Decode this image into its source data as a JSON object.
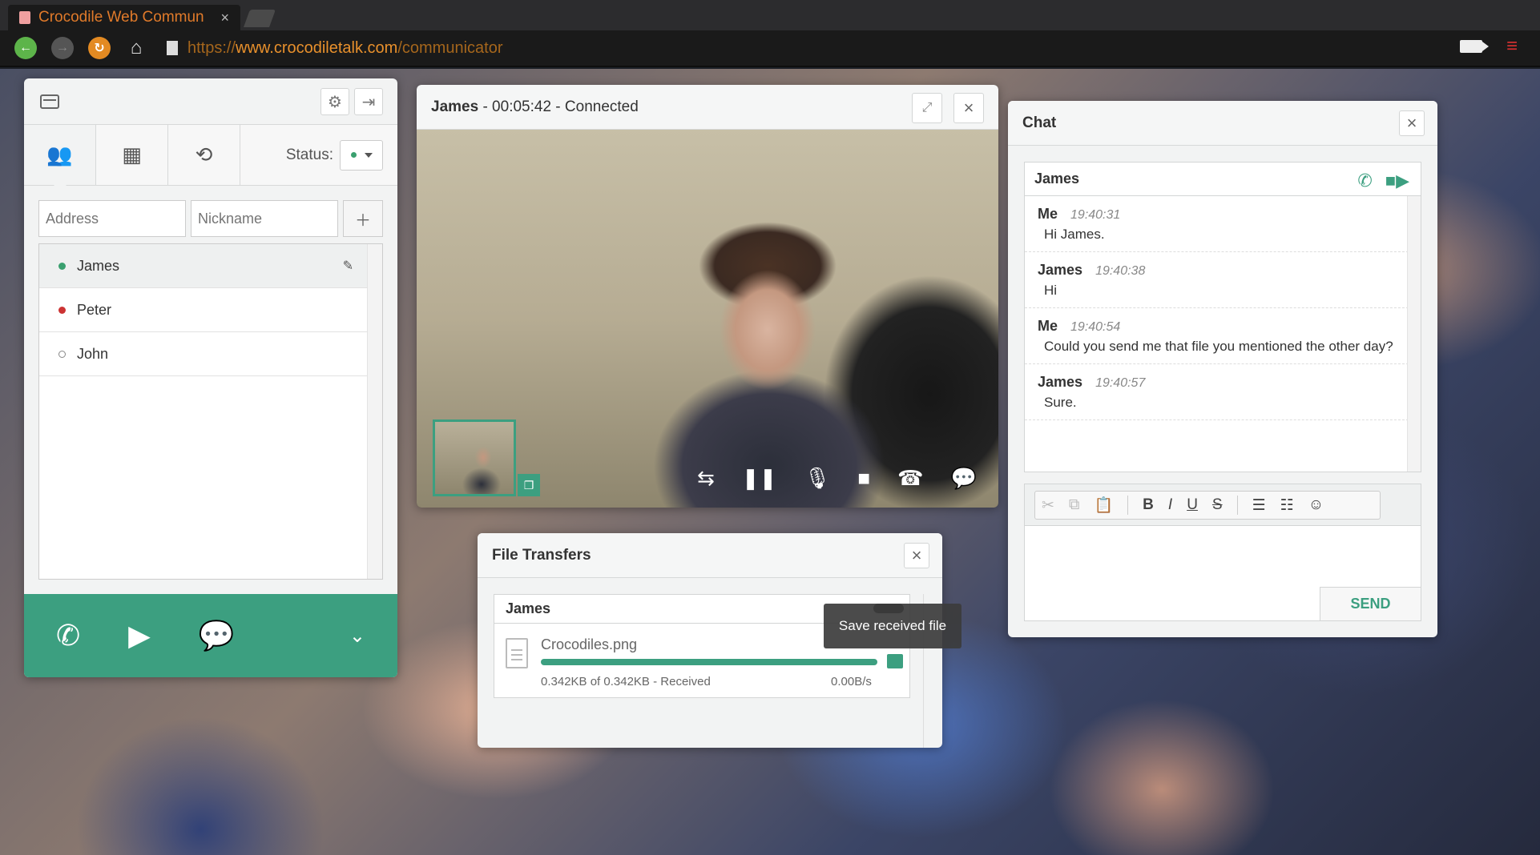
{
  "browser": {
    "tab_title": "Crocodile Web Commun",
    "url_scheme": "https://",
    "url_host": "www.crocodiletalk.com",
    "url_path": "/communicator"
  },
  "contacts": {
    "status_label": "Status:",
    "address_placeholder": "Address",
    "nickname_placeholder": "Nickname",
    "items": [
      {
        "name": "James",
        "status": "online"
      },
      {
        "name": "Peter",
        "status": "busy"
      },
      {
        "name": "John",
        "status": "offline"
      }
    ]
  },
  "video": {
    "caller": "James",
    "meta": " - 00:05:42 - Connected"
  },
  "chat": {
    "title": "Chat",
    "contact": "James",
    "messages": [
      {
        "from": "Me",
        "time": "19:40:31",
        "text": "Hi James."
      },
      {
        "from": "James",
        "time": "19:40:38",
        "text": "Hi"
      },
      {
        "from": "Me",
        "time": "19:40:54",
        "text": "Could you send me that file you mentioned the other day?"
      },
      {
        "from": "James",
        "time": "19:40:57",
        "text": "Sure."
      }
    ],
    "send_label": "SEND"
  },
  "files": {
    "title": "File Transfers",
    "contact": "James",
    "file_name": "Crocodiles.png",
    "status": "0.342KB of 0.342KB - Received",
    "rate": "0.00B/s",
    "progress": 1.0,
    "tooltip": "Save received file"
  },
  "colors": {
    "accent": "#3c9f80",
    "online": "#3aa06f",
    "busy": "#cc3333"
  }
}
